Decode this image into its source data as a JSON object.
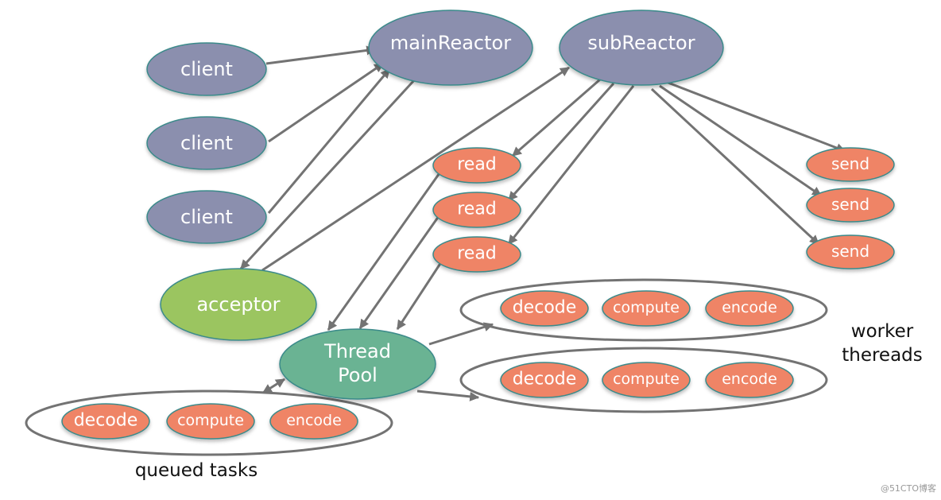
{
  "colors": {
    "reactor": "#8b8fae",
    "task": "#ef8466",
    "acceptor": "#9bc561",
    "threadpool": "#6ab393",
    "outline": "#3a8a8a",
    "arrow": "#737373"
  },
  "nodes": {
    "client1": "client",
    "client2": "client",
    "client3": "client",
    "mainReactor": "mainReactor",
    "subReactor": "subReactor",
    "read1": "read",
    "read2": "read",
    "read3": "read",
    "send1": "send",
    "send2": "send",
    "send3": "send",
    "acceptor": "acceptor",
    "threadpool_line1": "Thread",
    "threadpool_line2": "Pool",
    "w1_decode": "decode",
    "w1_compute": "compute",
    "w1_encode": "encode",
    "w2_decode": "decode",
    "w2_compute": "compute",
    "w2_encode": "encode",
    "q_decode": "decode",
    "q_compute": "compute",
    "q_encode": "encode"
  },
  "labels": {
    "worker_line1": "worker",
    "worker_line2": "thereads",
    "queued": "queued tasks"
  },
  "watermark": "@51CTO博客",
  "edges": [
    [
      "client1",
      "mainReactor"
    ],
    [
      "client2",
      "mainReactor"
    ],
    [
      "client3",
      "mainReactor"
    ],
    [
      "mainReactor",
      "acceptor"
    ],
    [
      "acceptor",
      "subReactor"
    ],
    [
      "subReactor",
      "read1"
    ],
    [
      "subReactor",
      "read2"
    ],
    [
      "subReactor",
      "read3"
    ],
    [
      "subReactor",
      "send1"
    ],
    [
      "subReactor",
      "send2"
    ],
    [
      "subReactor",
      "send3"
    ],
    [
      "read1",
      "threadpool"
    ],
    [
      "read2",
      "threadpool"
    ],
    [
      "read3",
      "threadpool"
    ],
    [
      "threadpool",
      "worker-group-1"
    ],
    [
      "threadpool",
      "worker-group-2"
    ],
    [
      "threadpool",
      "queued-tasks"
    ]
  ]
}
